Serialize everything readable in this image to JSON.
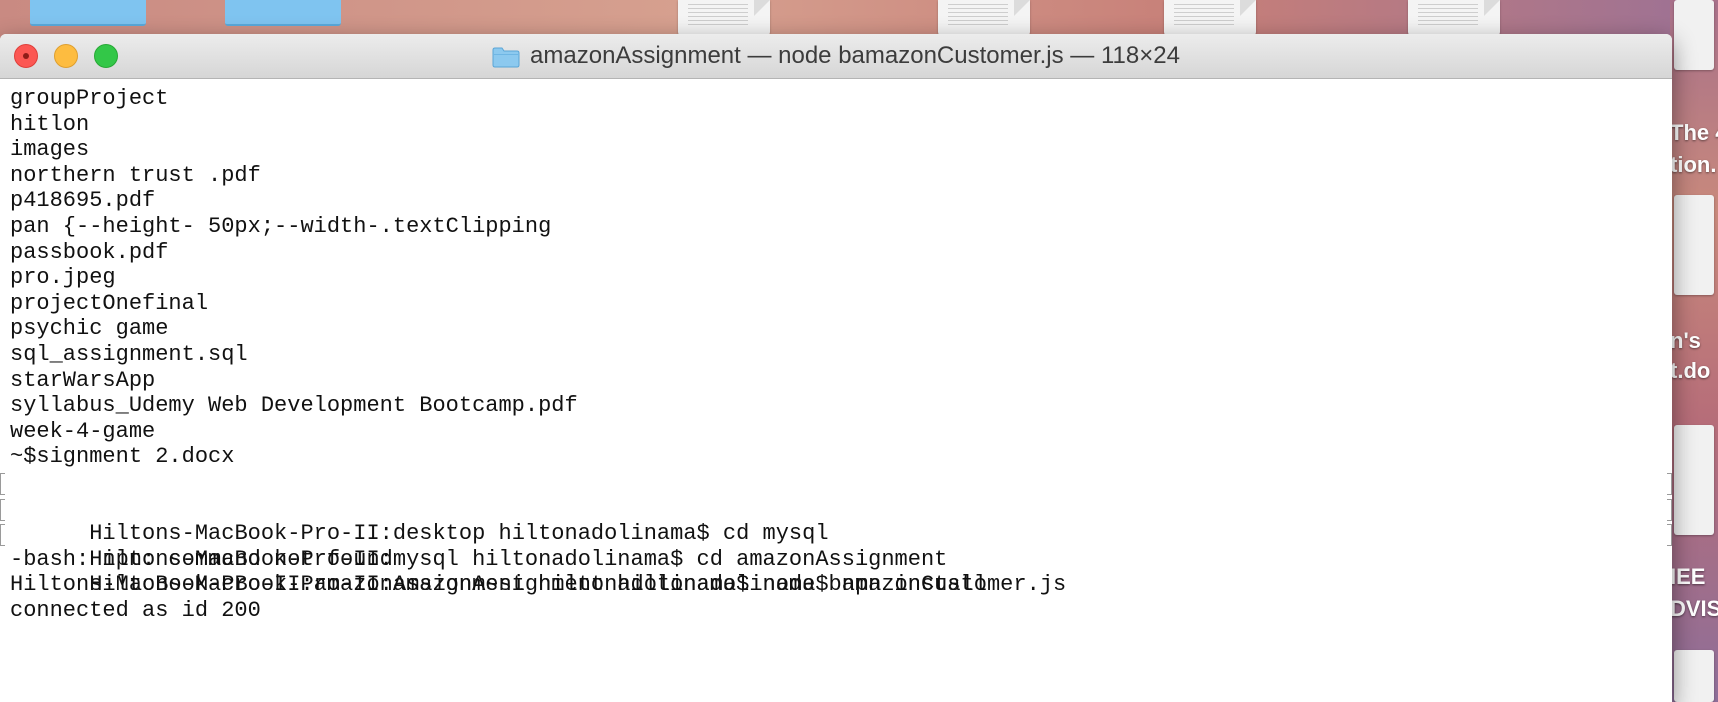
{
  "window": {
    "title": "amazonAssignment — node bamazonCustomer.js — 118×24",
    "folder_icon": "folder-icon",
    "buttons": {
      "close": "close-icon",
      "minimize": "minimize-icon",
      "zoom": "zoom-icon"
    }
  },
  "desktop": {
    "right_edge_text": [
      "The 4",
      "tion.",
      "n's",
      "t.do",
      "IEE",
      "DVIS"
    ]
  },
  "terminal": {
    "lines": [
      "groupProject",
      "hitlon",
      "images",
      "northern trust .pdf",
      "p418695.pdf",
      "pan {--height- 50px;--width-.textClipping",
      "passbook.pdf",
      "pro.jpeg",
      "projectOnefinal",
      "psychic game",
      "sql_assignment.sql",
      "starWarsApp",
      "syllabus_Udemy Web Development Bootcamp.pdf",
      "week-4-game",
      "~$signment 2.docx",
      "Hiltons-MacBook-Pro-II:desktop hiltonadolinama$ cd mysql",
      "Hiltons-MacBook-Pro-II:mysql hiltonadolinama$ cd amazonAssignment",
      "Hiltons-MacBook-Pro-II:amazonAssignment hiltonadolinama$ npn install",
      "-bash: npn: command not found",
      "Hiltons-MacBook-Pro-II:amazonAssignment hiltonadolinama$ node bamazonCustomer.js",
      "connected as id 200"
    ],
    "marked_lines": [
      15,
      16,
      17
    ]
  },
  "colors": {
    "close": "#fc5753",
    "minimize": "#fdbc40",
    "zoom": "#33c748",
    "folder": "#7fc4f0"
  }
}
